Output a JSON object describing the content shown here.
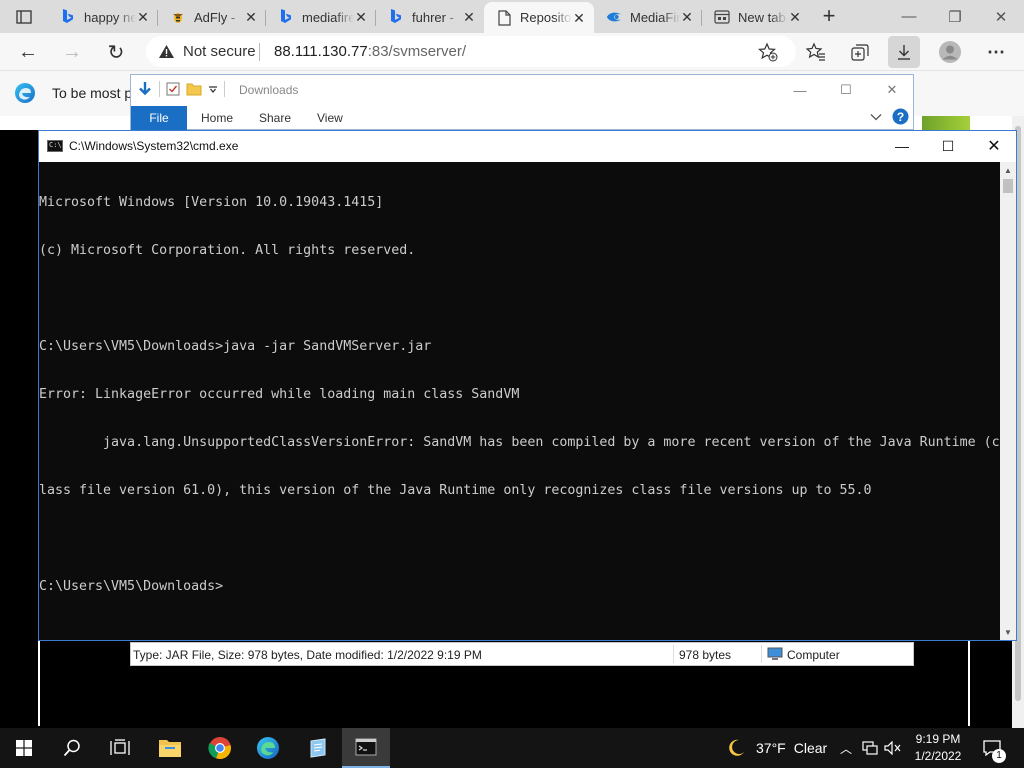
{
  "browser": {
    "tabs": [
      {
        "title": "happy new",
        "favicon": "bing-icon"
      },
      {
        "title": "AdFly - ",
        "favicon": "adfly-icon"
      },
      {
        "title": "mediafire",
        "favicon": "bing-icon"
      },
      {
        "title": "fuhrer - ",
        "favicon": "bing-icon"
      },
      {
        "title": "Repository",
        "favicon": "page-icon",
        "active": true
      },
      {
        "title": "MediaFire",
        "favicon": "mediafire-icon"
      },
      {
        "title": "New tab",
        "favicon": "newtab-icon"
      }
    ],
    "address": {
      "security": "Not secure",
      "host": "88.111.130.77",
      "path": ":83/svmserver/"
    },
    "infobar_text": "To be most pr"
  },
  "explorer": {
    "title": "Downloads",
    "ribbon_tabs": [
      "File",
      "Home",
      "Share",
      "View"
    ],
    "status": {
      "details": "Type: JAR File, Size: 978 bytes, Date modified: 1/2/2022 9:19 PM",
      "size": "978 bytes",
      "location": "Computer"
    }
  },
  "cmd": {
    "title": "C:\\Windows\\System32\\cmd.exe",
    "lines": [
      "Microsoft Windows [Version 10.0.19043.1415]",
      "(c) Microsoft Corporation. All rights reserved.",
      "",
      "C:\\Users\\VM5\\Downloads>java -jar SandVMServer.jar",
      "Error: LinkageError occurred while loading main class SandVM",
      "        java.lang.UnsupportedClassVersionError: SandVM has been compiled by a more recent version of the Java Runtime (c",
      "lass file version 61.0), this version of the Java Runtime only recognizes class file versions up to 55.0",
      "",
      "C:\\Users\\VM5\\Downloads>"
    ]
  },
  "taskbar": {
    "weather_temp": "37°F",
    "weather_desc": "Clear",
    "time": "9:19 PM",
    "date": "1/2/2022",
    "notification_count": "1"
  }
}
